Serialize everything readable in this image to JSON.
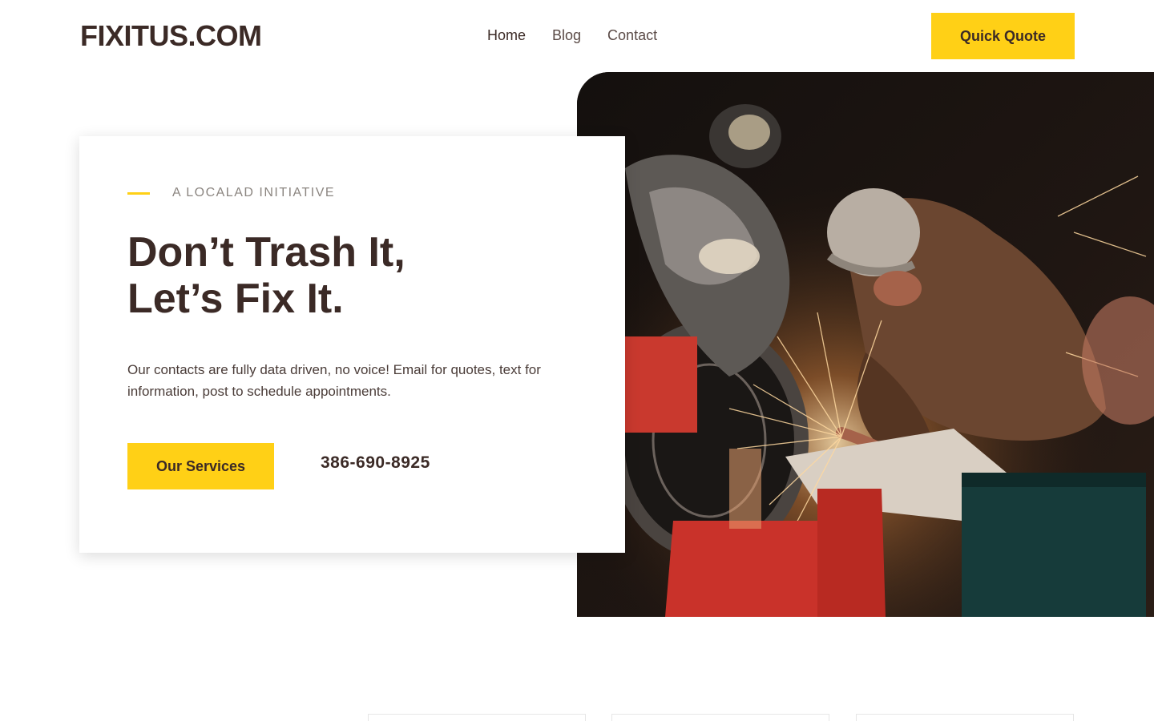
{
  "header": {
    "logo": "FIXITUS.COM",
    "nav": [
      "Home",
      "Blog",
      "Contact"
    ],
    "quote_button": "Quick Quote"
  },
  "hero": {
    "kicker": "A LOCALAD INITIATIVE",
    "headline_line1": "Don’t Trash It,",
    "headline_line2": "Let’s Fix It.",
    "description": "Our contacts are fully data driven, no voice! Email for quotes, text for information, post to schedule appointments.",
    "services_button": "Our Services",
    "phone": "386-690-8925"
  },
  "colors": {
    "accent": "#ffd016",
    "text": "#3b2a26"
  }
}
